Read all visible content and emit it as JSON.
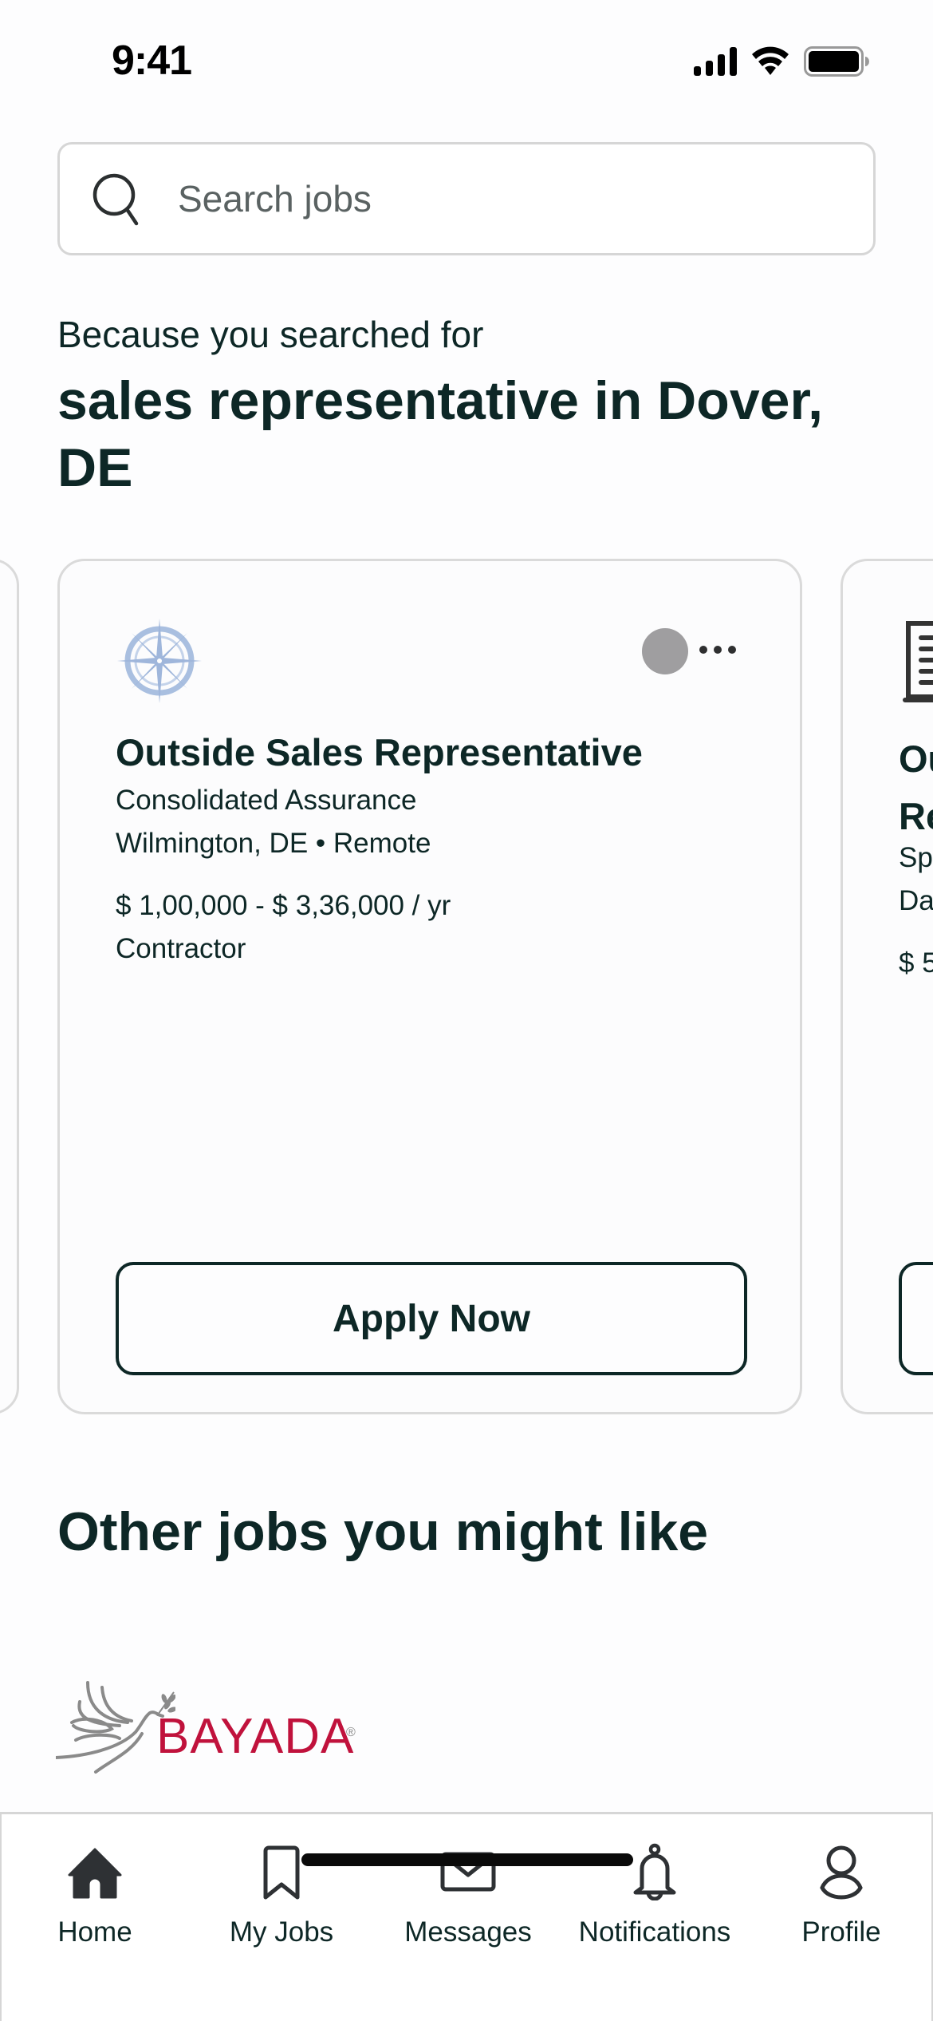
{
  "status_bar": {
    "time": "9:41",
    "icons": [
      "cellular-signal-icon",
      "wifi-icon",
      "battery-icon"
    ]
  },
  "search": {
    "placeholder": "Search jobs",
    "value": "",
    "icon": "search-icon"
  },
  "recommendations": {
    "intro": "Because you searched for",
    "query": "sales representative in Dover, DE"
  },
  "cards": {
    "main": {
      "logo": "compass-rose-logo",
      "title": "Outside Sales Representative",
      "company": "Consolidated Assurance",
      "location": "Wilmington, DE • Remote",
      "salary": "$ 1,00,000 - $ 3,36,000 / yr",
      "employment_type": "Contractor",
      "apply_label": "Apply Now",
      "status_color": "#9f9ea0"
    },
    "next": {
      "logo": "document-logo",
      "title_partial": "Ou Re",
      "title_line1": "Ou",
      "title_line2": "Re",
      "company_partial": "Sp",
      "location_partial": "Da",
      "salary_partial": "$ 5"
    }
  },
  "other_jobs": {
    "title": "Other jobs you might like",
    "first_company": {
      "name": "BAYADA",
      "registered": "®",
      "brand_color": "#c0123c"
    }
  },
  "tab_bar": {
    "active": "Home",
    "tabs": [
      {
        "label": "Home",
        "icon": "home-icon"
      },
      {
        "label": "My Jobs",
        "icon": "bookmark-icon"
      },
      {
        "label": "Messages",
        "icon": "envelope-icon"
      },
      {
        "label": "Notifications",
        "icon": "bell-icon"
      },
      {
        "label": "Profile",
        "icon": "person-icon"
      }
    ]
  },
  "colors": {
    "text_primary": "#0d2726",
    "border": "#d6d6d6",
    "brand_bayada": "#c0123c"
  }
}
